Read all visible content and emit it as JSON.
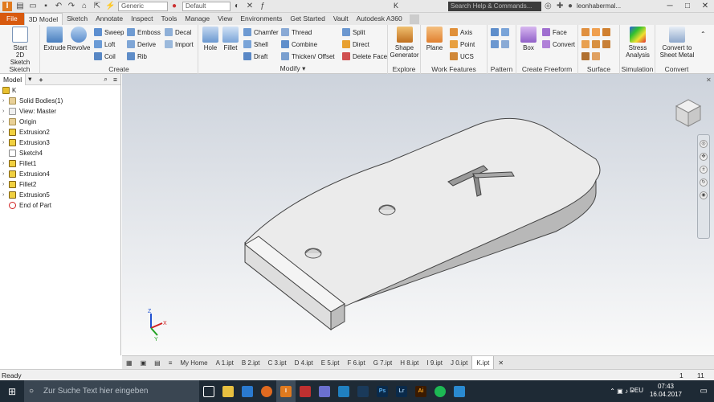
{
  "app": {
    "title": "K",
    "search_placeholder": "Search Help & Commands...",
    "user": "leonhabermal...",
    "material": "Generic",
    "appearance": "Default"
  },
  "tabs": [
    "File",
    "3D Model",
    "Sketch",
    "Annotate",
    "Inspect",
    "Tools",
    "Manage",
    "View",
    "Environments",
    "Get Started",
    "Vault",
    "Autodesk A360"
  ],
  "ribbon": {
    "sketch": {
      "title": "Sketch",
      "start": "Start\n2D Sketch"
    },
    "create": {
      "title": "Create",
      "extrude": "Extrude",
      "revolve": "Revolve",
      "sweep": "Sweep",
      "loft": "Loft",
      "coil": "Coil",
      "emboss": "Emboss",
      "derive": "Derive",
      "rib": "Rib",
      "decal": "Decal",
      "import": "Import"
    },
    "modify": {
      "title": "Modify",
      "hole": "Hole",
      "fillet": "Fillet",
      "chamfer": "Chamfer",
      "shell": "Shell",
      "draft": "Draft",
      "thread": "Thread",
      "combine": "Combine",
      "thicken": "Thicken/ Offset",
      "split": "Split",
      "direct": "Direct",
      "delete_face": "Delete Face"
    },
    "explore": {
      "title": "Explore",
      "shape_gen": "Shape\nGenerator"
    },
    "work": {
      "title": "Work Features",
      "plane": "Plane",
      "axis": "Axis",
      "point": "Point",
      "ucs": "UCS"
    },
    "pattern": {
      "title": "Pattern"
    },
    "freeform": {
      "title": "Create Freeform",
      "box": "Box",
      "face": "Face",
      "convert": "Convert"
    },
    "surface": {
      "title": "Surface"
    },
    "simulation": {
      "title": "Simulation",
      "stress": "Stress\nAnalysis"
    },
    "convert": {
      "title": "Convert",
      "sheet": "Convert to\nSheet Metal"
    }
  },
  "browser": {
    "tab": "Model",
    "root": "K",
    "items": [
      "Solid Bodies(1)",
      "View: Master",
      "Origin",
      "Extrusion2",
      "Extrusion3",
      "Sketch4",
      "Fillet1",
      "Extrusion4",
      "Fillet2",
      "Extrusion5",
      "End of Part"
    ]
  },
  "doc_tabs": [
    "My Home",
    "A 1.ipt",
    "B 2.ipt",
    "C 3.ipt",
    "D 4.ipt",
    "E 5.ipt",
    "F 6.ipt",
    "G 7.ipt",
    "H 8.ipt",
    "I 9.ipt",
    "J 0.ipt",
    "K.ipt"
  ],
  "status": {
    "text": "Ready",
    "count1": "1",
    "count2": "11"
  },
  "taskbar": {
    "search": "Zur Suche Text hier eingeben",
    "lang": "DEU",
    "time": "07:43",
    "date": "16.04.2017"
  },
  "viewport": {
    "engraving": "K"
  }
}
